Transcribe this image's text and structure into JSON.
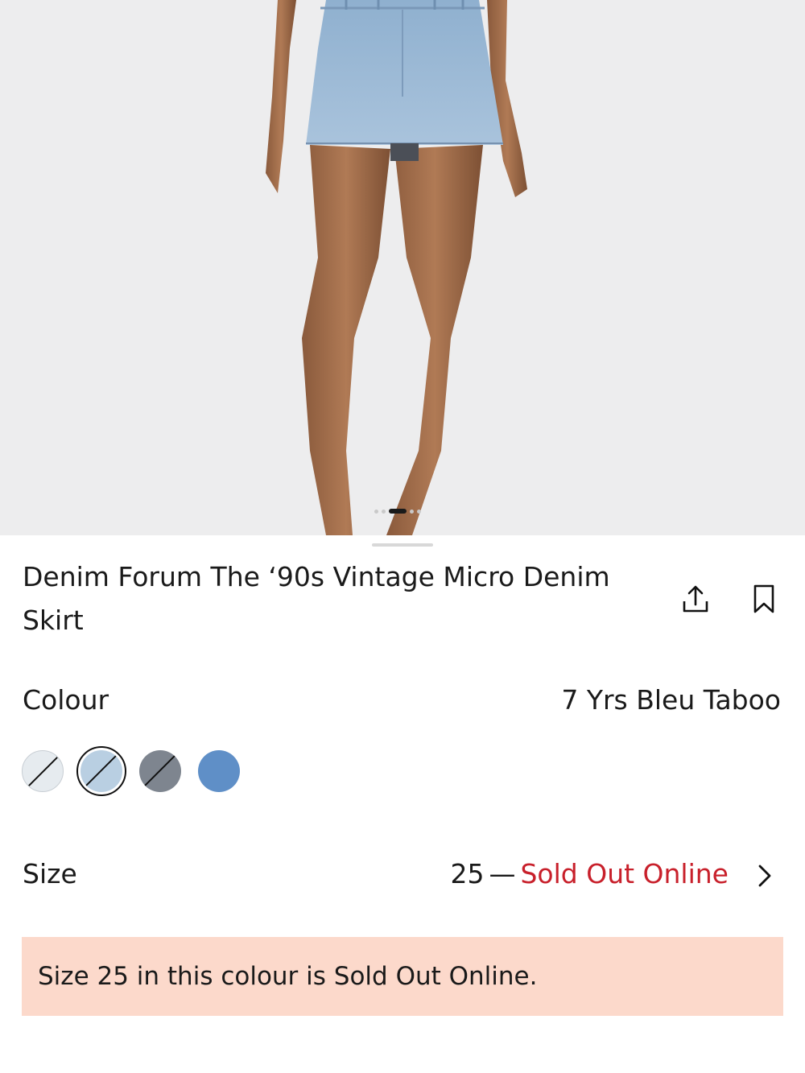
{
  "product": {
    "title": "Denim Forum The ‘90s Vintage Micro Denim Skirt",
    "image_alt": "Model wearing light blue denim micro skirt",
    "carousel": {
      "count": 5,
      "active_index": 2
    }
  },
  "actions": {
    "share_icon": "share-icon",
    "bookmark_icon": "bookmark-icon"
  },
  "colour": {
    "label": "Colour",
    "selected_value": "7 Yrs Bleu Taboo",
    "swatches": [
      {
        "name": "light-wash",
        "color": "#e6ebef",
        "sold_out": true,
        "selected": false
      },
      {
        "name": "bleu-taboo",
        "color": "#b9cfe2",
        "sold_out": true,
        "selected": true
      },
      {
        "name": "grey-wash",
        "color": "#7e858f",
        "sold_out": true,
        "selected": false
      },
      {
        "name": "mid-blue",
        "color": "#5f8fc7",
        "sold_out": false,
        "selected": false
      }
    ]
  },
  "size": {
    "label": "Size",
    "value": "25",
    "separator": "—",
    "status": "Sold Out Online"
  },
  "notice": {
    "text": "Size 25 in this colour is Sold Out Online."
  },
  "colors": {
    "sold_out": "#c8202b",
    "notice_bg": "#fcd9cb"
  }
}
